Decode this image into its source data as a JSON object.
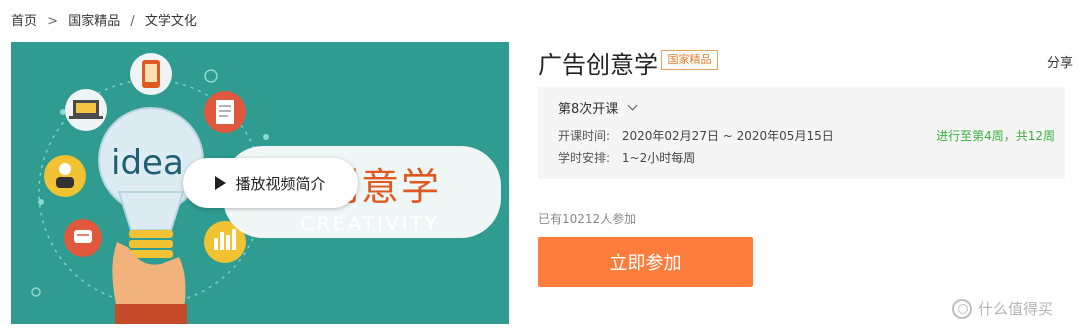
{
  "breadcrumb": {
    "home": "首页",
    "sep1": ">",
    "category": "国家精品",
    "sep2": "/",
    "subcategory": "文学文化"
  },
  "banner": {
    "play_label": "播放视频简介",
    "bulb_text": "idea",
    "title_art": "广告创意学",
    "creativity": "CREATIVITY",
    "colors": {
      "background": "#2f9b91",
      "title_art": "#e0591f",
      "bulb": "#dcecf2"
    }
  },
  "course": {
    "title": "广告创意学",
    "tag": "国家精品",
    "share": "分享"
  },
  "session": {
    "selected": "第8次开课",
    "time_label": "开课时间:",
    "time_value": "2020年02月27日 ~ 2020年05月15日",
    "schedule_label": "学时安排:",
    "schedule_value": "1~2小时每周",
    "progress": "进行至第4周，共12周"
  },
  "enroll": {
    "count_text": "已有10212人参加",
    "button_label": "立即参加",
    "button_color": "#ff7d3c"
  },
  "watermark": {
    "text": "什么值得买"
  }
}
